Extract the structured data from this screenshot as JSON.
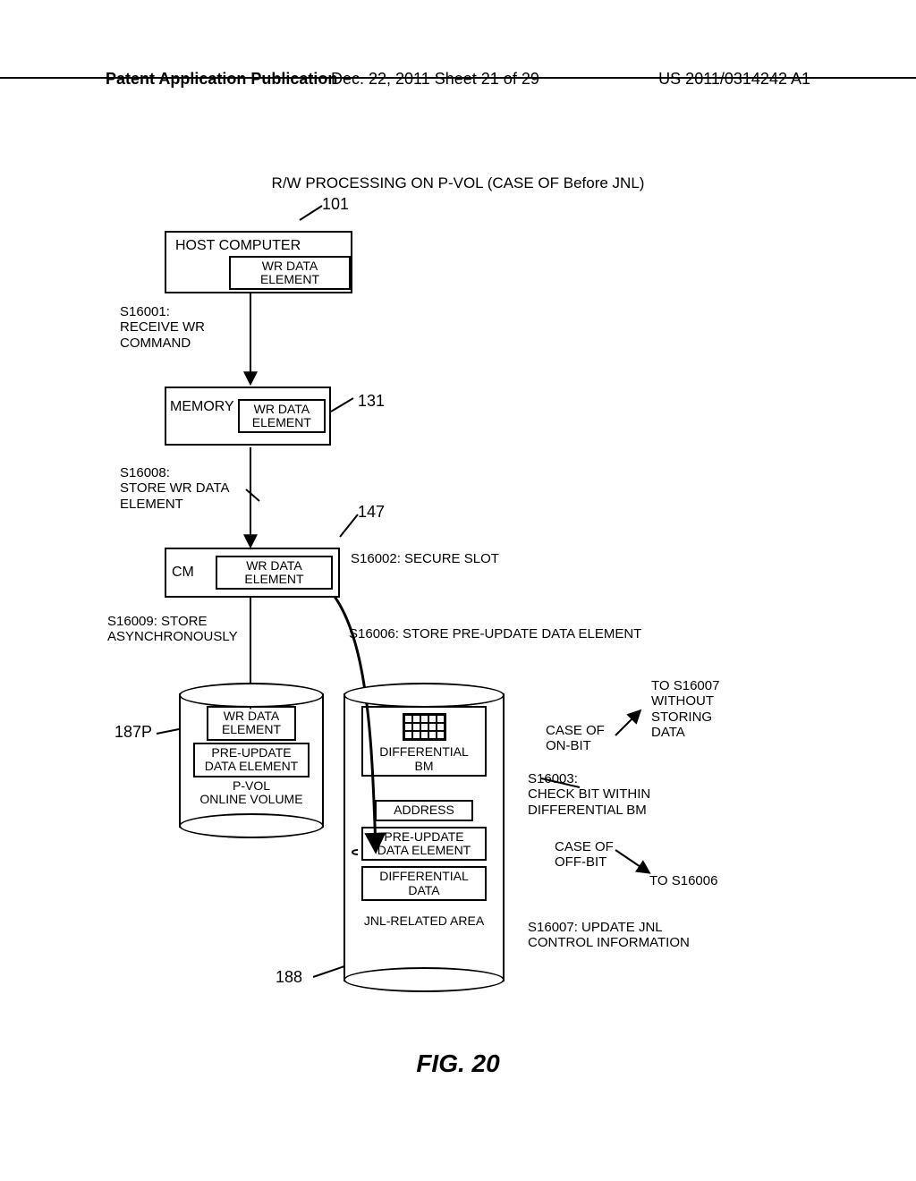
{
  "header": {
    "left": "Patent Application Publication",
    "center": "Dec. 22, 2011  Sheet 21 of 29",
    "right": "US 2011/0314242 A1"
  },
  "title": "R/W PROCESSING ON P-VOL (CASE OF Before JNL)",
  "figure_label": "FIG. 20",
  "refs": {
    "r101": "101",
    "r131": "131",
    "r147": "147",
    "r187P": "187P",
    "r188": "188"
  },
  "boxes": {
    "host": "HOST COMPUTER",
    "wr_data_element": "WR DATA\nELEMENT",
    "memory": "MEMORY",
    "cm": "CM",
    "pvol_top": "WR DATA\nELEMENT",
    "pvol_mid": "PRE-UPDATE\nDATA ELEMENT",
    "pvol_name": "P-VOL\nONLINE VOLUME",
    "diff_bm": "DIFFERENTIAL\nBM",
    "address": "ADDRESS",
    "preupdate2": "PRE-UPDATE\nDATA ELEMENT",
    "diff_data": "DIFFERENTIAL\nDATA",
    "jnl_area": "JNL-RELATED AREA"
  },
  "steps": {
    "s16001": "S16001:\nRECEIVE WR\nCOMMAND",
    "s16008": "S16008:\nSTORE WR DATA\nELEMENT",
    "s16009": "S16009: STORE\nASYNCHRONOUSLY",
    "s16002": "S16002:  SECURE SLOT",
    "s16006": "S16006: STORE PRE-UPDATE DATA ELEMENT",
    "s16003": "S16003:\nCHECK BIT WITHIN\nDIFFERENTIAL BM",
    "s16007": "S16007: UPDATE JNL\nCONTROL INFORMATION",
    "case_on": "CASE OF\nON-BIT",
    "case_off": "CASE OF\nOFF-BIT",
    "to_s16007": "TO S16007\nWITHOUT\nSTORING\nDATA",
    "to_s16006": "TO S16006"
  }
}
